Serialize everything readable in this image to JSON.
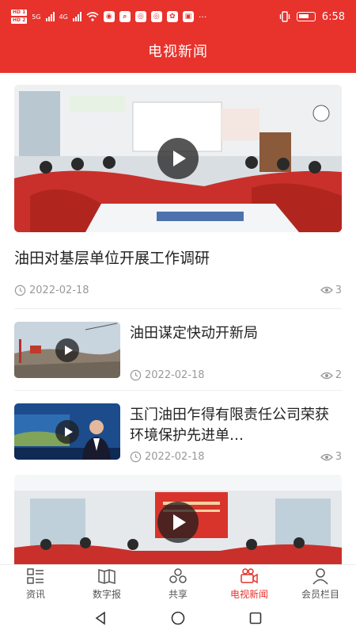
{
  "status_bar": {
    "time": "6:58",
    "hd_1": "HD 1",
    "hd_2": "HD 2",
    "net_1": "5G",
    "net_2": "4G",
    "more": "···"
  },
  "header": {
    "title": "电视新闻"
  },
  "feature": {
    "title": "油田对基层单位开展工作调研",
    "date": "2022-02-18",
    "views": "3"
  },
  "news": [
    {
      "title": "油田谋定快动开新局",
      "date": "2022-02-18",
      "views": "2"
    },
    {
      "title": "玉门油田乍得有限责任公司荣获环境保护先进单…",
      "date": "2022-02-18",
      "views": "3"
    }
  ],
  "tabs": [
    {
      "label": "资讯",
      "icon": "list-icon"
    },
    {
      "label": "数字报",
      "icon": "newspaper-icon"
    },
    {
      "label": "共享",
      "icon": "share-icon"
    },
    {
      "label": "电视新闻",
      "icon": "video-camera-icon",
      "active": true
    },
    {
      "label": "会员栏目",
      "icon": "user-icon"
    }
  ],
  "colors": {
    "accent": "#e8322c",
    "meta": "#999999"
  }
}
